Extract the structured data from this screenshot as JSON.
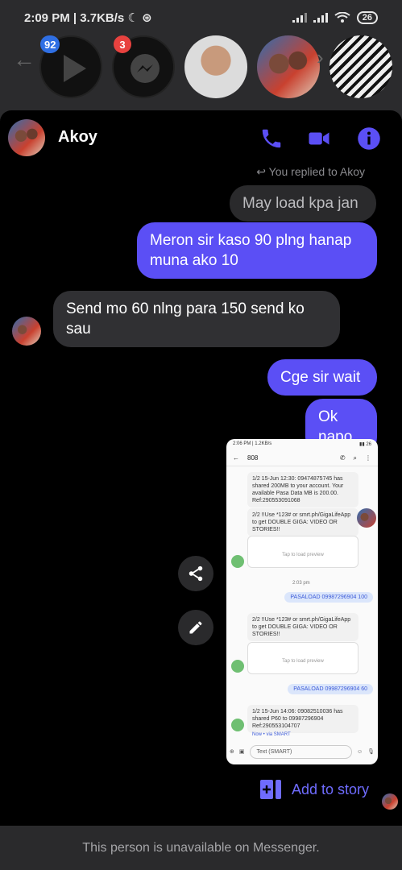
{
  "status_bar": {
    "time": "2:09 PM",
    "speed": "3.7KB/s",
    "battery": "26"
  },
  "chat_heads": {
    "badges": [
      "92",
      "3"
    ]
  },
  "header": {
    "name": "Akoy"
  },
  "reply_note": "You replied to Akoy",
  "messages": [
    {
      "type": "replied",
      "text": "May load kpa jan"
    },
    {
      "type": "out",
      "text": "Meron sir kaso 90 plng hanap muna ako 10"
    },
    {
      "type": "in",
      "text": "Send mo 60 nlng para 150 send ko sau"
    },
    {
      "type": "out",
      "text": "Cge sir wait"
    },
    {
      "type": "out",
      "text": "Ok napo"
    }
  ],
  "screenshot": {
    "status_time": "2:06 PM | 1.2KB/s",
    "title": "808",
    "msg1": "1/2 15-Jun 12:30: 09474875745 has shared 200MB to your account. Your available Pasa Data MB is 200.00. Ref:290553091068",
    "msg2": "2/2 !!Use *123# or smrt.ph/GigaLifeApp to get DOUBLE GIGA: VIDEO OR STORIES!!",
    "preview": "Tap to load preview",
    "time_label": "2:03 pm",
    "sent1": "PASALOAD 09987296904 100",
    "msg3": "2/2 !!Use *123# or smrt.ph/GigaLifeApp to get DOUBLE GIGA: VIDEO OR STORIES!!",
    "sent2": "PASALOAD 09987296904 60",
    "msg4": "1/2 15-Jun 14:06: 09082510036 has shared P60 to 09987296904 Ref:290553104707",
    "via": "Now • via SMART",
    "compose_placeholder": "Text (SMART)"
  },
  "add_to_story": "Add to story",
  "footer_text": "This person is unavailable on Messenger.",
  "colors": {
    "accent": "#5b4ff5",
    "link": "#6f6cff",
    "badge_blue": "#2f6fe4",
    "badge_red": "#e8423f"
  }
}
